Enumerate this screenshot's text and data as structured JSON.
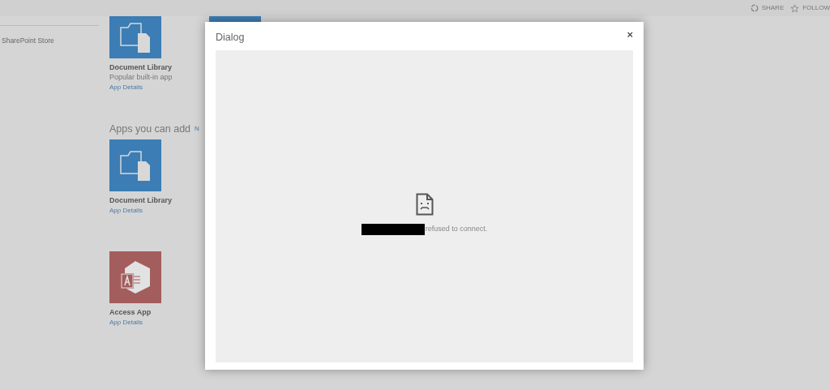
{
  "top_bar": {
    "actions": [
      {
        "label": "SHARE",
        "kind": "share"
      },
      {
        "label": "FOLLOW",
        "kind": "follow"
      }
    ]
  },
  "sidebar": {
    "items": [
      {
        "label": "SharePoint Store"
      }
    ]
  },
  "apps": [
    {
      "name": "Document Library",
      "description": "Popular built-in app",
      "link": "App Details",
      "kind": "library"
    }
  ],
  "section": {
    "heading": "Apps you can add",
    "link": "N"
  },
  "apps_to_add": [
    {
      "name": "Document Library",
      "link": "App Details",
      "kind": "library"
    },
    {
      "name": "Access App",
      "link": "App Details",
      "kind": "access"
    }
  ],
  "dialog": {
    "title": "Dialog",
    "close": "×",
    "message": "refused to connect."
  }
}
